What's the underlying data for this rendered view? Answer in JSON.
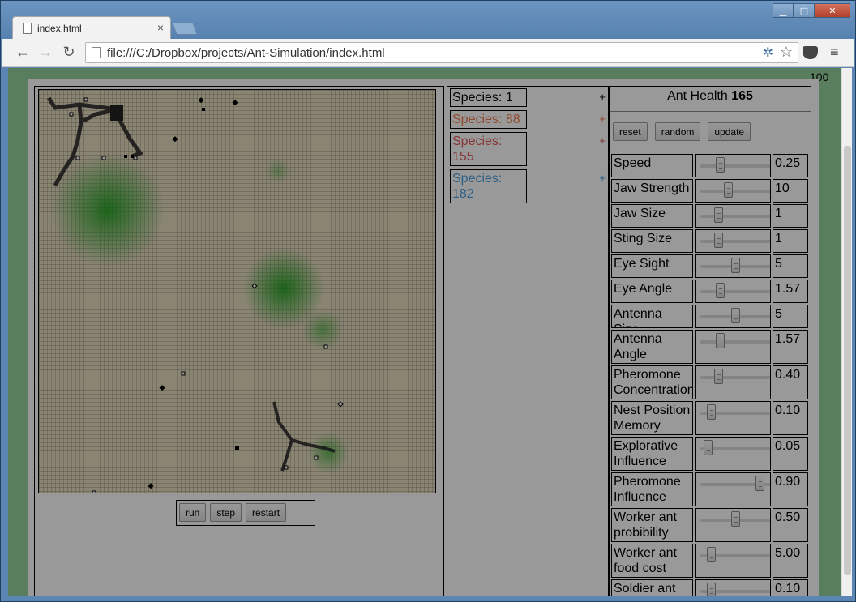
{
  "browser": {
    "tab_title": "index.html",
    "url": "file:///C:/Dropbox/projects/Ant-Simulation/index.html",
    "window_controls": {
      "minimize": "▁",
      "maximize": "□",
      "close": "✕"
    }
  },
  "sim": {
    "counter": "100",
    "controls": {
      "run": "run",
      "step": "step",
      "restart": "restart"
    }
  },
  "species_list": [
    {
      "label": "Species: 1",
      "color": "#000000",
      "plus": "+"
    },
    {
      "label": "Species: 88",
      "color": "#f07b4a",
      "plus": "+"
    },
    {
      "label": "Species: 155",
      "color": "#e05a5a",
      "plus": "+"
    },
    {
      "label": "Species: 182",
      "color": "#4a9ee0",
      "plus": "+"
    }
  ],
  "panel": {
    "health_label": "Ant Health",
    "health_value": "165",
    "buttons": {
      "reset": "reset",
      "random": "random",
      "update": "update"
    },
    "params": [
      {
        "label": "Speed",
        "value": "0.25",
        "pos": 0.25
      },
      {
        "label": "Jaw Strength",
        "value": "10",
        "pos": 0.38
      },
      {
        "label": "Jaw Size",
        "value": "1",
        "pos": 0.22
      },
      {
        "label": "Sting Size",
        "value": "1",
        "pos": 0.22
      },
      {
        "label": "Eye Sight",
        "value": "5",
        "pos": 0.5
      },
      {
        "label": "Eye Angle",
        "value": "1.57",
        "pos": 0.25
      },
      {
        "label": "Antenna Size",
        "value": "5",
        "pos": 0.5
      },
      {
        "label": "Antenna Angle",
        "value": "1.57",
        "pos": 0.25
      },
      {
        "label": "Pheromone Concentration",
        "value": "0.40",
        "pos": 0.22
      },
      {
        "label": "Nest Position Memory",
        "value": "0.10",
        "pos": 0.1
      },
      {
        "label": "Explorative Influence",
        "value": "0.05",
        "pos": 0.05
      },
      {
        "label": "Pheromone Influence",
        "value": "0.90",
        "pos": 0.9
      },
      {
        "label": "Worker ant probibility",
        "value": "0.50",
        "pos": 0.5
      },
      {
        "label": "Worker ant food cost",
        "value": "5.00",
        "pos": 0.1
      },
      {
        "label": "Soldier ant",
        "value": "0.10",
        "pos": 0.1
      }
    ]
  }
}
